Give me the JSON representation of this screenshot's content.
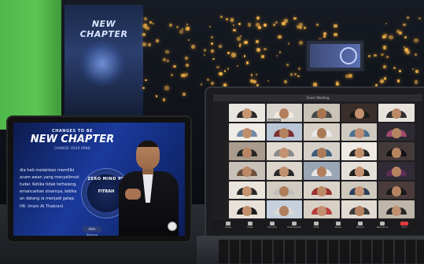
{
  "backdrop": {
    "banner_title": "NEW CHAPTER",
    "bokeh_color": "#f4b54a",
    "green_screen_color": "#4fb84a"
  },
  "tablet": {
    "heading_small": "CHANGES TO BE",
    "heading_big": "NEW CHAPTER",
    "heading_sub": "CHANGE YOUR MIND",
    "quote_text": "dia hati melainkan memiliki acam awan yang menyelimuti tudar. Ketika tidak terhalang, emancarkan sinarnya, ketika an datang ia menjadi gelap.",
    "quote_author": "HR. Imam At Thabrani",
    "wheel_ring_text": "ZERO MIND PR",
    "wheel_center_text": "FITRAH",
    "cc_button": "Hide Stream",
    "accent_color": "#1a3a9c"
  },
  "laptop": {
    "window_title": "Zoom Meeting",
    "participants": [
      {
        "name": "",
        "bg": "#e9e6e1",
        "face": "#c69572",
        "body": "#2b2b2b"
      },
      {
        "name": "Ratih Putri",
        "bg": "#d8d3cc",
        "face": "#b47f5d",
        "body": "#efe9e0"
      },
      {
        "name": "",
        "bg": "#c9c2b6",
        "face": "#a77450",
        "body": "#4a4a4a"
      },
      {
        "name": "",
        "bg": "#3a2e2a",
        "face": "#c2916f",
        "body": "#1b1b1b"
      },
      {
        "name": "",
        "bg": "#e7e2db",
        "face": "#ba8a66",
        "body": "#303030"
      },
      {
        "name": "",
        "bg": "#f0ece6",
        "face": "#c18e6b",
        "body": "#6f8aa8"
      },
      {
        "name": "",
        "bg": "#b9c6d6",
        "face": "#b58260",
        "body": "#7d2f2f"
      },
      {
        "name": "",
        "bg": "#d7d0c6",
        "face": "#a97a58",
        "body": "#e9e9e9"
      },
      {
        "name": "",
        "bg": "#cfc9c0",
        "face": "#c19072",
        "body": "#4c6f8e"
      },
      {
        "name": "",
        "bg": "#2e2a33",
        "face": "#b58463",
        "body": "#a04a6c"
      },
      {
        "name": "",
        "bg": "#a99c8c",
        "face": "#b78563",
        "body": "#262626"
      },
      {
        "name": "",
        "bg": "#e0dad1",
        "face": "#c39273",
        "body": "#8a8a8a"
      },
      {
        "name": "",
        "bg": "#d4cfc7",
        "face": "#ad7b59",
        "body": "#3b5b7a"
      },
      {
        "name": "",
        "bg": "#efeae3",
        "face": "#bf8e6b",
        "body": "#2a2a2a"
      },
      {
        "name": "",
        "bg": "#453a3a",
        "face": "#b88361",
        "body": "#141414"
      },
      {
        "name": "",
        "bg": "#c8c1b8",
        "face": "#b98864",
        "body": "#6a4e3c"
      },
      {
        "name": "",
        "bg": "#dcd5cb",
        "face": "#c08f6e",
        "body": "#2a2a2a"
      },
      {
        "name": "",
        "bg": "#9aa6b6",
        "face": "#b07e5c",
        "body": "#e6e6e6"
      },
      {
        "name": "",
        "bg": "#e4dfd8",
        "face": "#c29170",
        "body": "#1f1f1f"
      },
      {
        "name": "",
        "bg": "#302b36",
        "face": "#b58360",
        "body": "#5e2d58"
      },
      {
        "name": "",
        "bg": "#e9e4dc",
        "face": "#c3946f",
        "body": "#2a2a2a"
      },
      {
        "name": "",
        "bg": "#d2cbc1",
        "face": "#ad7d5c",
        "body": "#c0c0c0"
      },
      {
        "name": "",
        "bg": "#d9d3ca",
        "face": "#bd8b68",
        "body": "#993030"
      },
      {
        "name": "",
        "bg": "#cfc8bd",
        "face": "#c49372",
        "body": "#2d3f5a"
      },
      {
        "name": "",
        "bg": "#4a3c3a",
        "face": "#b68461",
        "body": "#181818"
      },
      {
        "name": "",
        "bg": "#e7e1d9",
        "face": "#c08e6b",
        "body": "#1d1d1d"
      },
      {
        "name": "",
        "bg": "#c7d0dc",
        "face": "#b07f5e",
        "body": "#d9d9d9"
      },
      {
        "name": "",
        "bg": "#d8d0c4",
        "face": "#c19172",
        "body": "#ba3b3b"
      },
      {
        "name": "",
        "bg": "#e1dbd3",
        "face": "#b48260",
        "body": "#3a3a3a"
      },
      {
        "name": "",
        "bg": "#bfb6aa",
        "face": "#c09070",
        "body": "#262626"
      }
    ],
    "toolbar": [
      {
        "label": "Mute",
        "icon": "microphone-icon"
      },
      {
        "label": "Video",
        "icon": "video-icon"
      },
      {
        "label": "Security",
        "icon": "shield-icon"
      },
      {
        "label": "Participants",
        "icon": "people-icon"
      },
      {
        "label": "Chat",
        "icon": "chat-icon"
      },
      {
        "label": "Share",
        "icon": "share-screen-icon"
      },
      {
        "label": "Record",
        "icon": "record-icon"
      },
      {
        "label": "Reactions",
        "icon": "reaction-icon"
      },
      {
        "label": "End",
        "icon": "end-call-icon"
      }
    ]
  }
}
